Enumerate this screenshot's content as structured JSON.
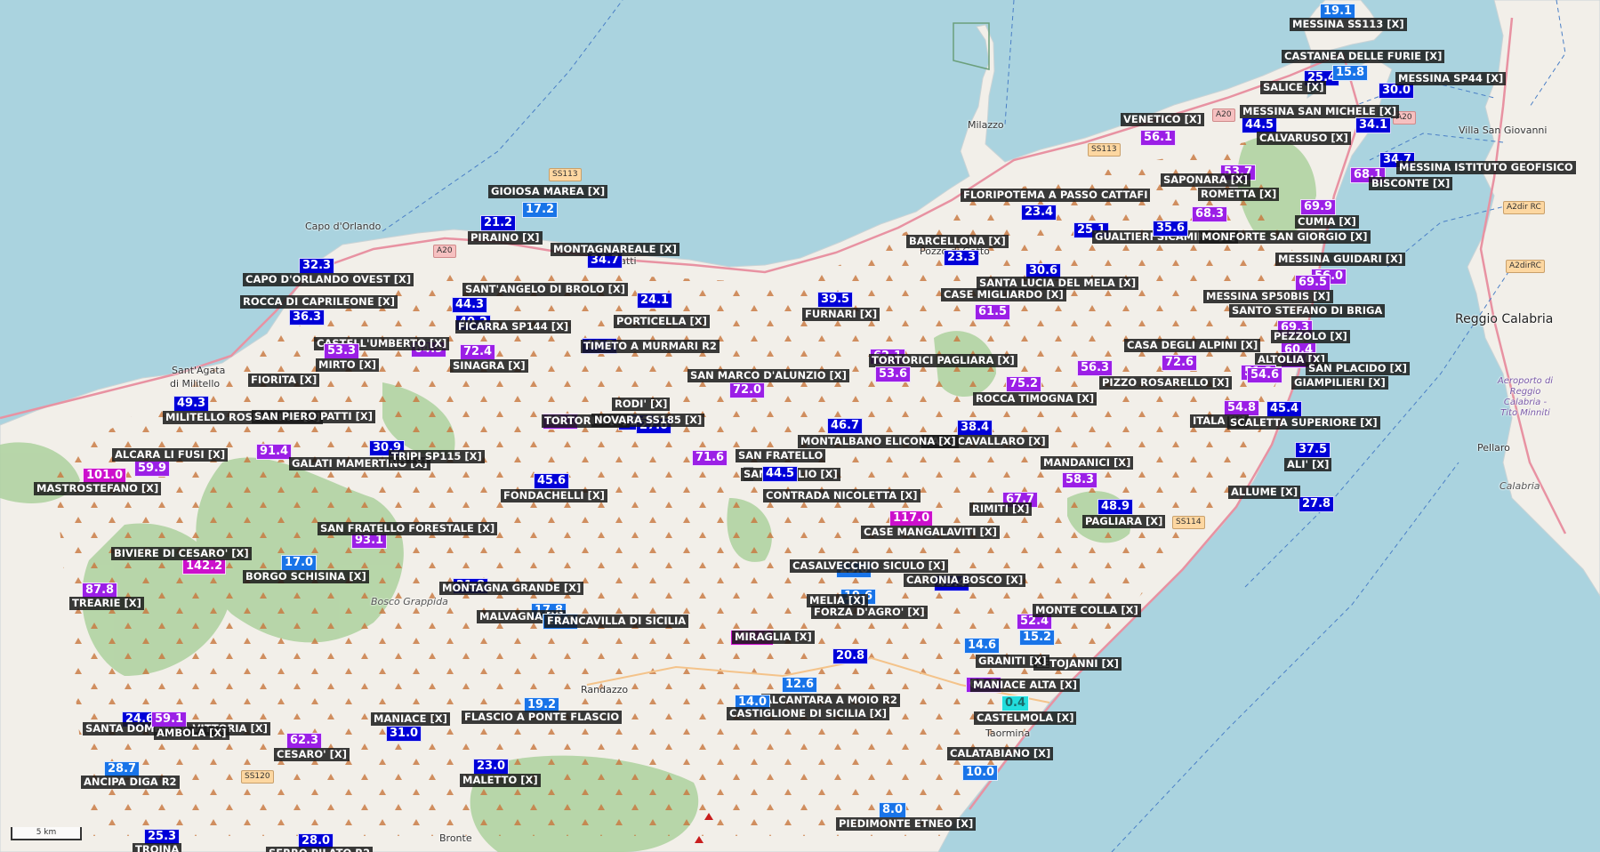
{
  "colors": {
    "sea": "#aad3df",
    "land": "#f2efe9",
    "forest": "#add19e",
    "road": "#e892a2",
    "v_blue": "#0000d8",
    "v_mid": "#1974e8",
    "v_purple": "#9b1fe6",
    "v_magenta": "#cc10cc",
    "v_cyan": "#22dddd",
    "v_gray": "#9a9a9a",
    "label_bg": "#191919"
  },
  "icons": {
    "peak": "peak-triangle-icon",
    "volcano": "volcano-peak-icon"
  },
  "scale_label": "5 km",
  "places": [
    {
      "name": "Milazzo"
    },
    {
      "name": "Capo d'Orlando"
    },
    {
      "name": "Sant'Agata"
    },
    {
      "name": "di Militello"
    },
    {
      "name": "Patti"
    },
    {
      "name": "Pozzo di Gotto"
    },
    {
      "name": "Villa San Giovanni"
    },
    {
      "name": "Reggio Calabria"
    },
    {
      "name": "Pellaro"
    },
    {
      "name": "Calabria"
    },
    {
      "name": "Randazzo"
    },
    {
      "name": "Taormina"
    },
    {
      "name": "Bronte"
    },
    {
      "name": "Bosco Grappida"
    },
    {
      "name": "Aeroporto di Reggio Calabria - Tito Minniti"
    }
  ],
  "shields": [
    "SS113",
    "SS113",
    "A20",
    "A20",
    "A20",
    "SS114",
    "SS120",
    "A2dir RC",
    "A2dirRC"
  ],
  "stations": [
    {
      "label": "MESSINA SS113 [X]",
      "value": "19.1",
      "color": "#1974e8"
    },
    {
      "label": "CASTANEA DELLE FURIE [X]",
      "value": "25.4",
      "color": "#0000d8"
    },
    {
      "label": "SALICE [X]",
      "value": "15.8",
      "color": "#1974e8"
    },
    {
      "label": "MESSINA SP44 [X]",
      "value": "30.0",
      "color": "#0000d8"
    },
    {
      "label": "MESSINA SAN MICHELE [X]",
      "value": "44.5",
      "color": "#0000d8"
    },
    {
      "label": "CALVARUSO [X]",
      "value": "34.1",
      "color": "#0000d8"
    },
    {
      "label": "VENETICO [X]",
      "value": "56.1",
      "color": "#9b1fe6"
    },
    {
      "label": "MESSINA ISTITUTO GEOFISICO",
      "value": "34.7",
      "color": "#0000d8"
    },
    {
      "label": "BISCONTE [X]",
      "value": "68.1",
      "color": "#9b1fe6"
    },
    {
      "label": "SAPONARA [X]",
      "value": "53.7",
      "color": "#9b1fe6"
    },
    {
      "label": "ROMETTA [X]",
      "value": "68.3",
      "color": "#9b1fe6"
    },
    {
      "label": "CUMIA [X]",
      "value": "69.9",
      "color": "#9b1fe6"
    },
    {
      "label": "FLORIPOTEMA A PASSO CATTAFI",
      "value": "23.4",
      "color": "#0000d8"
    },
    {
      "label": "GUALTIERI SICAMINO [X]",
      "value": "25.1",
      "color": "#0000d8"
    },
    {
      "label": "MONFORTE SAN GIORGIO [X]",
      "value": "35.6",
      "color": "#0000d8"
    },
    {
      "label": "BARCELLONA [X]",
      "value": "23.3",
      "color": "#0000d8"
    },
    {
      "label": "MESSINA GUIDARI [X]",
      "value": "56.0",
      "color": "#9b1fe6"
    },
    {
      "label": "SANTA LUCIA DEL MELA [X]",
      "value": "30.6",
      "color": "#0000d8"
    },
    {
      "label": "CASE MIGLIARDO [X]",
      "value": "61.5",
      "color": "#9b1fe6"
    },
    {
      "label": "MESSINA SP50BIS [X]",
      "value": "69.5",
      "color": "#9b1fe6"
    },
    {
      "label": "SANTO STEFANO DI BRIGA",
      "value": "69.3",
      "color": "#9b1fe6"
    },
    {
      "label": "PEZZOLO [X]",
      "value": "60.4",
      "color": "#9b1fe6"
    },
    {
      "label": "CASA DEGLI ALPINI [X]",
      "value": "72.6",
      "color": "#9b1fe6"
    },
    {
      "label": "ALTOLIA [X]",
      "value": "60.0",
      "color": "#9b1fe6"
    },
    {
      "label": "SAN PLACIDO [X]",
      "value": "51.2",
      "color": "#9b1fe6"
    },
    {
      "label": "PIZZO ROSARELLO [X]",
      "value": "56.3",
      "color": "#9b1fe6"
    },
    {
      "label": "GIAMPILIERI [X]",
      "value": "54.6",
      "color": "#9b1fe6"
    },
    {
      "label": "ROCCA TIMOGNA [X]",
      "value": "75.2",
      "color": "#9b1fe6"
    },
    {
      "label": "ITALA [X]",
      "value": "54.8",
      "color": "#9b1fe6"
    },
    {
      "label": "SCALETTA SUPERIORE [X]",
      "value": "45.4",
      "color": "#0000d8"
    },
    {
      "label": "CASE CAVALLARO [X]",
      "value": "38.4",
      "color": "#0000d8"
    },
    {
      "label": "ALI' [X]",
      "value": "37.5",
      "color": "#0000d8"
    },
    {
      "label": "MANDANICI [X]",
      "value": "58.3",
      "color": "#9b1fe6"
    },
    {
      "label": "ALLUME [X]",
      "value": "27.8",
      "color": "#0000d8"
    },
    {
      "label": "RIMITI [X]",
      "value": "67.7",
      "color": "#9b1fe6"
    },
    {
      "label": "PAGLIARA [X]",
      "value": "48.9",
      "color": "#0000d8"
    },
    {
      "label": "GIOIOSA MAREA [X]",
      "value": "17.2",
      "color": "#1974e8"
    },
    {
      "label": "PIRAINO [X]",
      "value": "21.2",
      "color": "#0000d8"
    },
    {
      "label": "MONTAGNAREALE [X]",
      "value": "34.7",
      "color": "#0000d8"
    },
    {
      "label": "CAPO D'ORLANDO OVEST [X]",
      "value": "32.3",
      "color": "#0000d8"
    },
    {
      "label": "ROCCA DI CAPRILEONE [X]",
      "value": "36.3",
      "color": "#0000d8"
    },
    {
      "label": "SANT'ANGELO DI BROLO [X]",
      "value": "44.3",
      "color": "#0000d8"
    },
    {
      "label": "FICARRA SP144 [X]",
      "value": "40.2",
      "color": "#0000d8"
    },
    {
      "label": "PORTICELLA [X]",
      "value": "24.1",
      "color": "#0000d8"
    },
    {
      "label": "FURNARI [X]",
      "value": "39.5",
      "color": "#0000d8"
    },
    {
      "label": "CASTELL'UMBERTO [X]",
      "value": "64.9",
      "color": "#9b1fe6"
    },
    {
      "label": "MIRTO [X]",
      "value": "53.3",
      "color": "#9b1fe6"
    },
    {
      "label": "SINAGRA [X]",
      "value": "72.4",
      "color": "#9b1fe6"
    },
    {
      "label": "TIMETO A MURMARI R2",
      "value": "40.3",
      "color": "#0000d8"
    },
    {
      "label": "RODI' [X]",
      "value": "43.7",
      "color": "#0000d8"
    },
    {
      "label": "SAN MARCO D'ALUNZIO [X]",
      "value": "72.0",
      "color": "#9b1fe6"
    },
    {
      "label": "TORTORICI [X]",
      "value": "95.1",
      "color": "#9b1fe6"
    },
    {
      "label": "TORTORICI PAGLIARA [X]",
      "value": "62.1",
      "color": "#9b1fe6"
    },
    {
      "label": "FIORITA [X]",
      "value": "53.6",
      "color": "#9b1fe6"
    },
    {
      "label": "MILITELLO ROSMARINO [X]",
      "value": "49.3",
      "color": "#0000d8"
    },
    {
      "label": "SAN PIERO PATTI [X]",
      "value": "",
      "color": ""
    },
    {
      "label": "NOVARA SS185 [X]",
      "value": "27.0",
      "color": "#0000d8"
    },
    {
      "label": "MONTALBANO ELICONA [X]",
      "value": "46.7",
      "color": "#0000d8"
    },
    {
      "label": "SAN FRATELLO",
      "value": "71.6",
      "color": "#9b1fe6"
    },
    {
      "label": "ALCARA LI FUSI [X]",
      "value": "59.9",
      "color": "#9b1fe6"
    },
    {
      "label": "GALATI MAMERTINO [X]",
      "value": "91.4",
      "color": "#9b1fe6"
    },
    {
      "label": "TRIPI SP115 [X]",
      "value": "30.9",
      "color": "#0000d8"
    },
    {
      "label": "SAN BASILIO [X]",
      "value": "-",
      "color": "#9a9a9a"
    },
    {
      "label": "CONTRADA NICOLETTA [X]",
      "value": "44.5",
      "color": "#0000d8"
    },
    {
      "label": "MASTROSTEFANO [X]",
      "value": "101.0",
      "color": "#cc10cc"
    },
    {
      "label": "FONDACHELLI [X]",
      "value": "45.6",
      "color": "#0000d8"
    },
    {
      "label": "CASE MANGALAVITI [X]",
      "value": "117.0",
      "color": "#cc10cc"
    },
    {
      "label": "SAN FRATELLO FORESTALE [X]",
      "value": "93.1",
      "color": "#9b1fe6"
    },
    {
      "label": "BIVIERE DI CESARO' [X]",
      "value": "142.2",
      "color": "#cc10cc"
    },
    {
      "label": "BORGO SCHISINA [X]",
      "value": "17.0",
      "color": "#1974e8"
    },
    {
      "label": "CASALVECCHIO SICULO [X]",
      "value": "23.6",
      "color": "#1974e8"
    },
    {
      "label": "CARONIA BOSCO [X]",
      "value": "49.4",
      "color": "#0000d8"
    },
    {
      "label": "TREARIE [X]",
      "value": "87.8",
      "color": "#9b1fe6"
    },
    {
      "label": "MONTAGNA GRANDE [X]",
      "value": "21.8",
      "color": "#0000d8"
    },
    {
      "label": "FORZA D'AGRO' [X]",
      "value": "19.6",
      "color": "#1974e8"
    },
    {
      "label": "MONTE COLLA [X]",
      "value": "52.4",
      "color": "#9b1fe6"
    },
    {
      "label": "MALVAGNA [X]",
      "value": "17.8",
      "color": "#1974e8"
    },
    {
      "label": "FRANCAVILLA DI SICILIA",
      "value": "16.5",
      "color": "#1974e8"
    },
    {
      "label": "MIRAGLIA [X]",
      "value": "121.0",
      "color": "#cc10cc"
    },
    {
      "label": "SANTA DOMENICA VITTORIA [X]",
      "value": "24.6",
      "color": "#0000d8"
    },
    {
      "label": "MELIA [X]",
      "value": "20.8",
      "color": "#0000d8"
    },
    {
      "label": "ALCANTARA A MOIO R2",
      "value": "12.6",
      "color": "#1974e8"
    },
    {
      "label": "LETOJANNI [X]",
      "value": "15.2",
      "color": "#1974e8"
    },
    {
      "label": "GRANITI [X]",
      "value": "14.6",
      "color": "#1974e8"
    },
    {
      "label": "MANIACE ALTA [X]",
      "value": "63.8",
      "color": "#9b1fe6"
    },
    {
      "label": "CASTIGLIONE DI SICILIA [X]",
      "value": "14.0",
      "color": "#1974e8"
    },
    {
      "label": "CASTELMOLA [X]",
      "value": "0.4",
      "color": "#22dddd"
    },
    {
      "label": "FLASCIO A PONTE FLASCIO",
      "value": "19.2",
      "color": "#1974e8"
    },
    {
      "label": "MANIACE [X]",
      "value": "31.0",
      "color": "#0000d8"
    },
    {
      "label": "AMBOLA [X]",
      "value": "59.1",
      "color": "#9b1fe6"
    },
    {
      "label": "CESARO' [X]",
      "value": "62.3",
      "color": "#9b1fe6"
    },
    {
      "label": "CALATABIANO [X]",
      "value": "10.0",
      "color": "#1974e8"
    },
    {
      "label": "ANCIPA DIGA R2",
      "value": "28.7",
      "color": "#1974e8"
    },
    {
      "label": "MALETTO [X]",
      "value": "23.0",
      "color": "#0000d8"
    },
    {
      "label": "PIEDIMONTE ETNEO [X]",
      "value": "8.0",
      "color": "#1974e8"
    },
    {
      "label": "TROINA",
      "value": "25.3",
      "color": "#0000d8"
    },
    {
      "label": "SERRO PILATO R2",
      "value": "28.0",
      "color": "#0000d8"
    }
  ]
}
